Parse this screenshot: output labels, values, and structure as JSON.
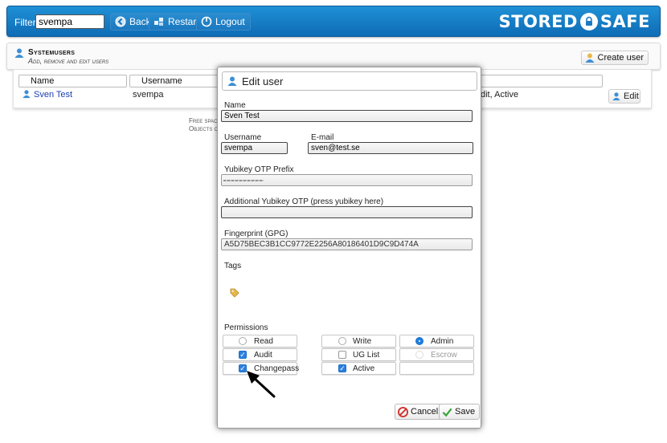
{
  "topbar": {
    "filter_label": "Filter:",
    "filter_value": "svempa",
    "back_label": "Back",
    "restart_label": "Restart",
    "logout_label": "Logout",
    "logo_left": "STORED",
    "logo_right": "SAFE"
  },
  "section": {
    "title": "Systemusers",
    "subtitle": "Add, remove and edit users",
    "create_label": "Create user"
  },
  "table": {
    "headers": [
      "Name",
      "Username"
    ],
    "row": {
      "name": "Sven Test",
      "username": "svempa",
      "status": "dit, Active",
      "edit_label": "Edit"
    },
    "free_space": "Free spac",
    "objects": "Objects cr"
  },
  "dialog": {
    "title": "Edit user",
    "name_label": "Name",
    "name_value": "Sven Test",
    "username_label": "Username",
    "username_value": "svempa",
    "email_label": "E-mail",
    "email_value": "sven@test.se",
    "yubikey_label": "Yubikey OTP Prefix",
    "yubikey_extra_label": "Additional Yubikey OTP (press yubikey here)",
    "fingerprint_label": "Fingerprint (GPG)",
    "fingerprint_value": "A5D75BEC3B1CC9772E2256A80186401D9C9D474A",
    "tags_label": "Tags",
    "permissions_label": "Permissions",
    "permissions": {
      "read": "Read",
      "write": "Write",
      "admin": "Admin",
      "audit": "Audit",
      "uglist": "UG List",
      "escrow": "Escrow",
      "changepass": "Changepass",
      "active": "Active"
    },
    "cancel_label": "Cancel",
    "save_label": "Save"
  },
  "colors": {
    "topbar": "#1a84cc",
    "radio_on": "#1f7fe0",
    "cancel_icon": "#d0332f",
    "save_icon": "#3aa63a"
  }
}
